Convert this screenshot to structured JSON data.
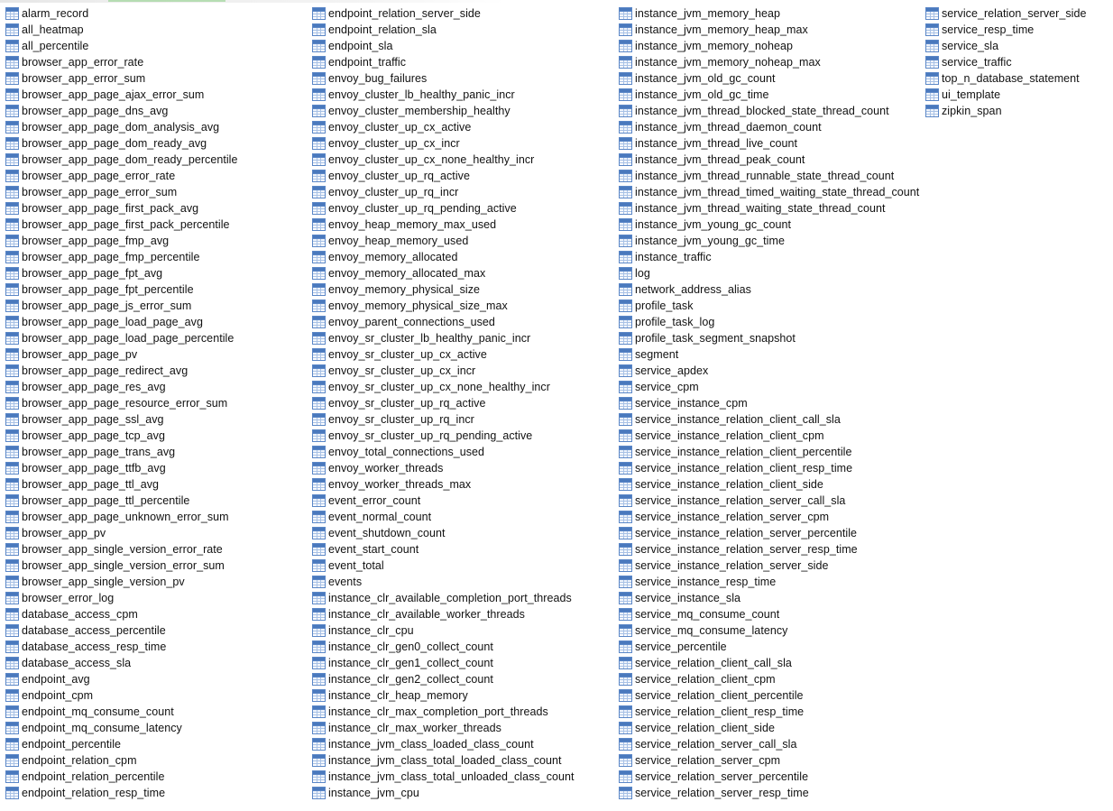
{
  "columns": [
    [
      "alarm_record",
      "all_heatmap",
      "all_percentile",
      "browser_app_error_rate",
      "browser_app_error_sum",
      "browser_app_page_ajax_error_sum",
      "browser_app_page_dns_avg",
      "browser_app_page_dom_analysis_avg",
      "browser_app_page_dom_ready_avg",
      "browser_app_page_dom_ready_percentile",
      "browser_app_page_error_rate",
      "browser_app_page_error_sum",
      "browser_app_page_first_pack_avg",
      "browser_app_page_first_pack_percentile",
      "browser_app_page_fmp_avg",
      "browser_app_page_fmp_percentile",
      "browser_app_page_fpt_avg",
      "browser_app_page_fpt_percentile",
      "browser_app_page_js_error_sum",
      "browser_app_page_load_page_avg",
      "browser_app_page_load_page_percentile",
      "browser_app_page_pv",
      "browser_app_page_redirect_avg",
      "browser_app_page_res_avg",
      "browser_app_page_resource_error_sum",
      "browser_app_page_ssl_avg",
      "browser_app_page_tcp_avg",
      "browser_app_page_trans_avg",
      "browser_app_page_ttfb_avg",
      "browser_app_page_ttl_avg",
      "browser_app_page_ttl_percentile",
      "browser_app_page_unknown_error_sum",
      "browser_app_pv",
      "browser_app_single_version_error_rate",
      "browser_app_single_version_error_sum",
      "browser_app_single_version_pv",
      "browser_error_log",
      "database_access_cpm",
      "database_access_percentile",
      "database_access_resp_time",
      "database_access_sla",
      "endpoint_avg",
      "endpoint_cpm",
      "endpoint_mq_consume_count",
      "endpoint_mq_consume_latency",
      "endpoint_percentile",
      "endpoint_relation_cpm",
      "endpoint_relation_percentile",
      "endpoint_relation_resp_time"
    ],
    [
      "endpoint_relation_server_side",
      "endpoint_relation_sla",
      "endpoint_sla",
      "endpoint_traffic",
      "envoy_bug_failures",
      "envoy_cluster_lb_healthy_panic_incr",
      "envoy_cluster_membership_healthy",
      "envoy_cluster_up_cx_active",
      "envoy_cluster_up_cx_incr",
      "envoy_cluster_up_cx_none_healthy_incr",
      "envoy_cluster_up_rq_active",
      "envoy_cluster_up_rq_incr",
      "envoy_cluster_up_rq_pending_active",
      "envoy_heap_memory_max_used",
      "envoy_heap_memory_used",
      "envoy_memory_allocated",
      "envoy_memory_allocated_max",
      "envoy_memory_physical_size",
      "envoy_memory_physical_size_max",
      "envoy_parent_connections_used",
      "envoy_sr_cluster_lb_healthy_panic_incr",
      "envoy_sr_cluster_up_cx_active",
      "envoy_sr_cluster_up_cx_incr",
      "envoy_sr_cluster_up_cx_none_healthy_incr",
      "envoy_sr_cluster_up_rq_active",
      "envoy_sr_cluster_up_rq_incr",
      "envoy_sr_cluster_up_rq_pending_active",
      "envoy_total_connections_used",
      "envoy_worker_threads",
      "envoy_worker_threads_max",
      "event_error_count",
      "event_normal_count",
      "event_shutdown_count",
      "event_start_count",
      "event_total",
      "events",
      "instance_clr_available_completion_port_threads",
      "instance_clr_available_worker_threads",
      "instance_clr_cpu",
      "instance_clr_gen0_collect_count",
      "instance_clr_gen1_collect_count",
      "instance_clr_gen2_collect_count",
      "instance_clr_heap_memory",
      "instance_clr_max_completion_port_threads",
      "instance_clr_max_worker_threads",
      "instance_jvm_class_loaded_class_count",
      "instance_jvm_class_total_loaded_class_count",
      "instance_jvm_class_total_unloaded_class_count",
      "instance_jvm_cpu"
    ],
    [
      "instance_jvm_memory_heap",
      "instance_jvm_memory_heap_max",
      "instance_jvm_memory_noheap",
      "instance_jvm_memory_noheap_max",
      "instance_jvm_old_gc_count",
      "instance_jvm_old_gc_time",
      "instance_jvm_thread_blocked_state_thread_count",
      "instance_jvm_thread_daemon_count",
      "instance_jvm_thread_live_count",
      "instance_jvm_thread_peak_count",
      "instance_jvm_thread_runnable_state_thread_count",
      "instance_jvm_thread_timed_waiting_state_thread_count",
      "instance_jvm_thread_waiting_state_thread_count",
      "instance_jvm_young_gc_count",
      "instance_jvm_young_gc_time",
      "instance_traffic",
      "log",
      "network_address_alias",
      "profile_task",
      "profile_task_log",
      "profile_task_segment_snapshot",
      "segment",
      "service_apdex",
      "service_cpm",
      "service_instance_cpm",
      "service_instance_relation_client_call_sla",
      "service_instance_relation_client_cpm",
      "service_instance_relation_client_percentile",
      "service_instance_relation_client_resp_time",
      "service_instance_relation_client_side",
      "service_instance_relation_server_call_sla",
      "service_instance_relation_server_cpm",
      "service_instance_relation_server_percentile",
      "service_instance_relation_server_resp_time",
      "service_instance_relation_server_side",
      "service_instance_resp_time",
      "service_instance_sla",
      "service_mq_consume_count",
      "service_mq_consume_latency",
      "service_percentile",
      "service_relation_client_call_sla",
      "service_relation_client_cpm",
      "service_relation_client_percentile",
      "service_relation_client_resp_time",
      "service_relation_client_side",
      "service_relation_server_call_sla",
      "service_relation_server_cpm",
      "service_relation_server_percentile",
      "service_relation_server_resp_time"
    ],
    [
      "service_relation_server_side",
      "service_resp_time",
      "service_sla",
      "service_traffic",
      "top_n_database_statement",
      "ui_template",
      "zipkin_span"
    ]
  ],
  "icon": "table-icon"
}
